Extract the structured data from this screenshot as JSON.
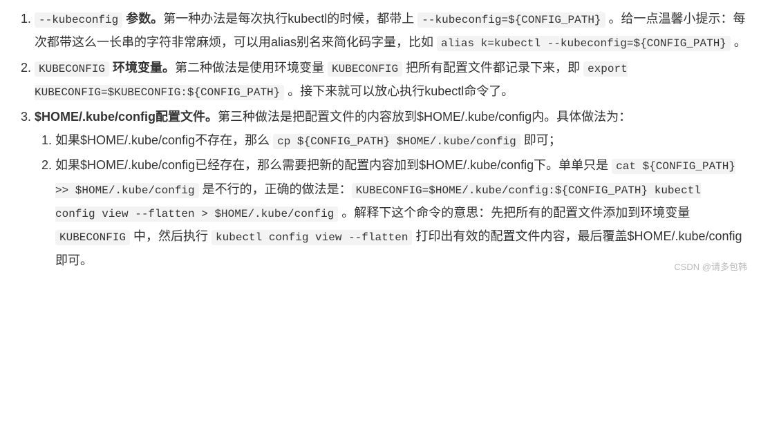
{
  "list": {
    "item1": {
      "code1": "--kubeconfig",
      "bold1": " 参数。",
      "text1": "第一种办法是每次执行kubectl的时候，都带上 ",
      "code2": "--kubeconfig=${CONFIG_PATH}",
      "text2": " 。给一点温馨小提示：每次都带这么一长串的字符非常麻烦，可以用alias别名来简化码字量，比如 ",
      "code3": "alias k=kubectl --kubeconfig=${CONFIG_PATH}",
      "text3": " 。"
    },
    "item2": {
      "code1": "KUBECONFIG",
      "bold1": " 环境变量。",
      "text1": "第二种做法是使用环境变量 ",
      "code2": "KUBECONFIG",
      "text2": " 把所有配置文件都记录下来，即 ",
      "code3": "export KUBECONFIG=$KUBECONFIG:${CONFIG_PATH}",
      "text3": " 。接下来就可以放心执行kubectl命令了。"
    },
    "item3": {
      "bold1": "$HOME/.kube/config配置文件。",
      "text1": "第三种做法是把配置文件的内容放到$HOME/.kube/config内。具体做法为：",
      "sub1": {
        "text1": "如果$HOME/.kube/config不存在，那么 ",
        "code1": "cp ${CONFIG_PATH} $HOME/.kube/config",
        "text2": " 即可；"
      },
      "sub2": {
        "text1": "如果$HOME/.kube/config已经存在，那么需要把新的配置内容加到$HOME/.kube/config下。单单只是 ",
        "code1": "cat ${CONFIG_PATH} >> $HOME/.kube/config",
        "text2": " 是不行的，正确的做法是：",
        "code2": "KUBECONFIG=$HOME/.kube/config:${CONFIG_PATH} kubectl config view --flatten > $HOME/.kube/config",
        "text3": " 。解释下这个命令的意思：先把所有的配置文件添加到环境变量 ",
        "code3": "KUBECONFIG",
        "text4": " 中，然后执行 ",
        "code4": "kubectl config view --flatten",
        "text5": " 打印出有效的配置文件内容，最后覆盖$HOME/.kube/config即可。"
      }
    }
  },
  "watermark": "CSDN @请多包韩"
}
